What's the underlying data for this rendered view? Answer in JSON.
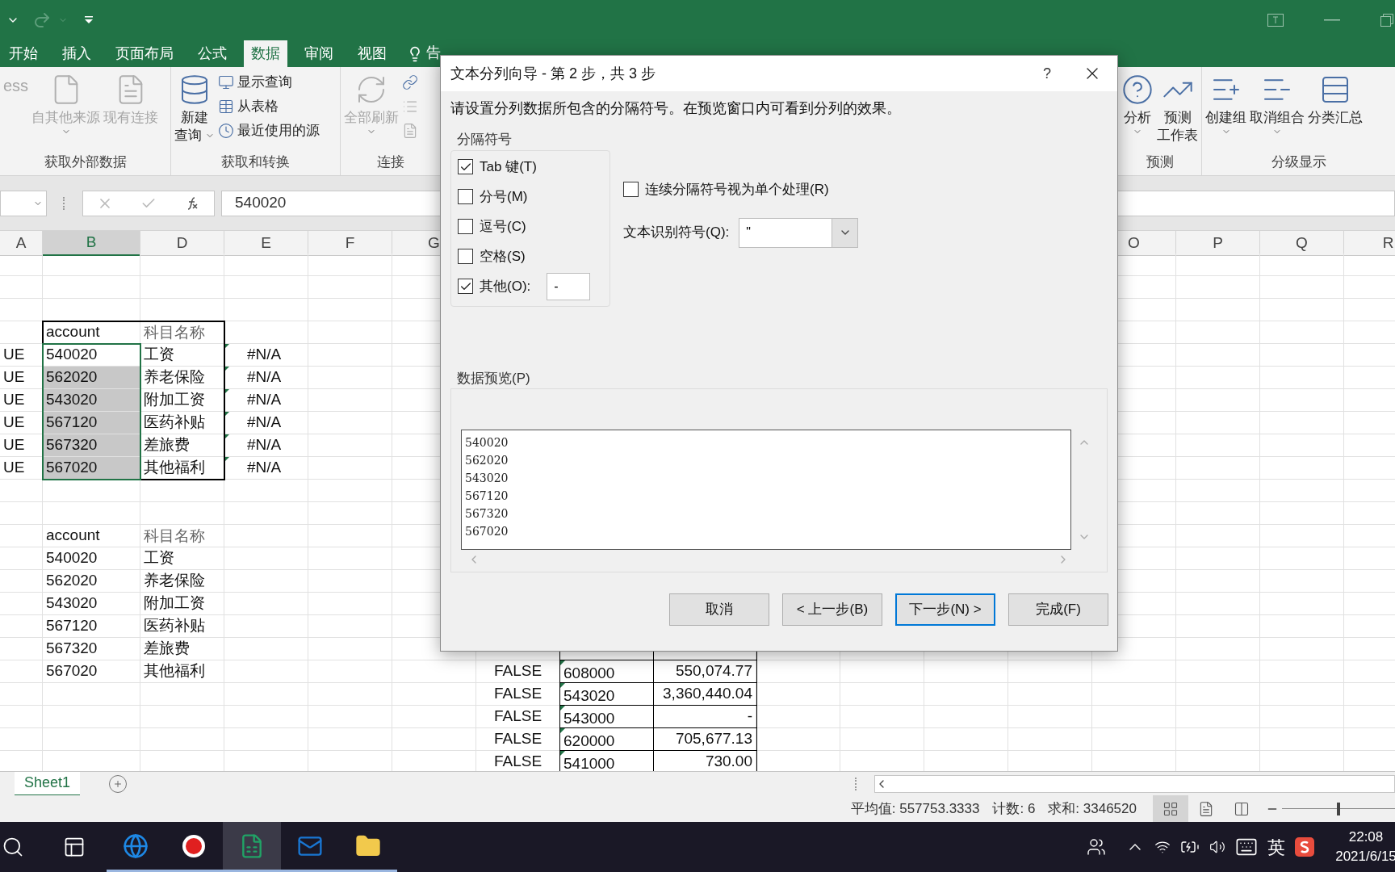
{
  "ribbon_tabs": [
    {
      "label": "开始",
      "selected": false
    },
    {
      "label": "插入",
      "selected": false
    },
    {
      "label": "页面布局",
      "selected": false
    },
    {
      "label": "公式",
      "selected": false
    },
    {
      "label": "数据",
      "selected": true
    },
    {
      "label": "审阅",
      "selected": false
    },
    {
      "label": "视图",
      "selected": false
    }
  ],
  "tell_me": "告",
  "ribbon_left": [
    {
      "label": "获取外部数据",
      "items": [
        {
          "kind": "text",
          "label": "ess",
          "disabled": true
        },
        {
          "kind": "large",
          "lines": [
            "自其他来源"
          ],
          "disabled": true,
          "dropdown": true
        },
        {
          "kind": "large",
          "lines": [
            "现有连接"
          ],
          "disabled": true,
          "dropdown": false
        }
      ]
    },
    {
      "label": "获取和转换",
      "items": [
        {
          "kind": "large",
          "lines": [
            "新建",
            "查询"
          ],
          "disabled": false,
          "dropdown": true
        },
        {
          "kind": "small",
          "label": "显示查询",
          "disabled": false
        },
        {
          "kind": "small",
          "label": "从表格",
          "disabled": false
        },
        {
          "kind": "small",
          "label": "最近使用的源",
          "disabled": false
        }
      ]
    },
    {
      "label": "连接",
      "items": [
        {
          "kind": "large",
          "lines": [
            "全部刷新"
          ],
          "disabled": true,
          "dropdown": true
        },
        {
          "kind": "small",
          "disabled": false
        },
        {
          "kind": "small",
          "disabled": true
        },
        {
          "kind": "small",
          "disabled": true
        }
      ]
    }
  ],
  "ribbon_right": [
    {
      "label": "预测",
      "items": [
        {
          "kind": "large",
          "lines": [
            "分析"
          ],
          "disabled": false,
          "dropdown": true
        },
        {
          "kind": "large",
          "lines": [
            "预测",
            "工作表"
          ],
          "disabled": false,
          "dropdown": false
        }
      ]
    },
    {
      "label": "分级显示",
      "items": [
        {
          "kind": "large",
          "lines": [
            "创建组"
          ],
          "disabled": false,
          "dropdown": true
        },
        {
          "kind": "large",
          "lines": [
            "取消组合"
          ],
          "disabled": false,
          "dropdown": true
        },
        {
          "kind": "large",
          "lines": [
            "分类汇总"
          ],
          "disabled": false,
          "dropdown": false
        }
      ]
    }
  ],
  "formula_bar": {
    "value": "540020"
  },
  "sheet": {
    "columns": [
      {
        "label": "A",
        "selected": false
      },
      {
        "label": "B",
        "selected": true
      },
      {
        "label": "D",
        "selected": false
      },
      {
        "label": "E",
        "selected": false
      },
      {
        "label": "F",
        "selected": false
      },
      {
        "label": "G",
        "selected": false
      },
      {
        "label": "O",
        "selected": false
      },
      {
        "label": "P",
        "selected": false
      },
      {
        "label": "Q",
        "selected": false
      },
      {
        "label": "R",
        "selected": false
      }
    ],
    "table1": {
      "header": {
        "account": "account",
        "name": "科目名称"
      },
      "rows": [
        {
          "col_a": "UE",
          "account": "540020",
          "name": "工资",
          "lookup": "#N/A",
          "selected": true,
          "active": true,
          "error_flag": true
        },
        {
          "col_a": "UE",
          "account": "562020",
          "name": "养老保险",
          "lookup": "#N/A",
          "selected": true,
          "active": false,
          "error_flag": true
        },
        {
          "col_a": "UE",
          "account": "543020",
          "name": "附加工资",
          "lookup": "#N/A",
          "selected": true,
          "active": false,
          "error_flag": true
        },
        {
          "col_a": "UE",
          "account": "567120",
          "name": "医药补贴",
          "lookup": "#N/A",
          "selected": true,
          "active": false,
          "error_flag": true
        },
        {
          "col_a": "UE",
          "account": "567320",
          "name": "差旅费",
          "lookup": "#N/A",
          "selected": true,
          "active": false,
          "error_flag": true
        },
        {
          "col_a": "UE",
          "account": "567020",
          "name": "其他福利",
          "lookup": "#N/A",
          "selected": true,
          "active": false,
          "error_flag": true
        }
      ]
    },
    "table2": {
      "header": {
        "account": "account",
        "name": "科目名称"
      },
      "rows": [
        {
          "account": "540020",
          "name": "工资"
        },
        {
          "account": "562020",
          "name": "养老保险"
        },
        {
          "account": "543020",
          "name": "附加工资"
        },
        {
          "account": "567120",
          "name": "医药补贴"
        },
        {
          "account": "567320",
          "name": "差旅费"
        },
        {
          "account": "567020",
          "name": "其他福利"
        }
      ]
    },
    "table3": {
      "rows": [
        {
          "flag": "FALSE",
          "code": "608000",
          "amount": "550,074.77",
          "error_flag": true
        },
        {
          "flag": "FALSE",
          "code": "543020",
          "amount": "3,360,440.04",
          "error_flag": true
        },
        {
          "flag": "FALSE",
          "code": "543000",
          "amount": "-",
          "error_flag": true
        },
        {
          "flag": "FALSE",
          "code": "620000",
          "amount": "705,677.13",
          "error_flag": true
        },
        {
          "flag": "FALSE",
          "code": "541000",
          "amount": "730.00",
          "error_flag": true
        }
      ]
    }
  },
  "dialog": {
    "title": "文本分列向导 - 第 2 步，共 3 步",
    "help": "?",
    "instruction": "请设置分列数据所包含的分隔符号。在预览窗口内可看到分列的效果。",
    "delimiters": {
      "legend": "分隔符号",
      "options": [
        {
          "label": "Tab 键(T)",
          "checked": true
        },
        {
          "label": "分号(M)",
          "checked": false
        },
        {
          "label": "逗号(C)",
          "checked": false
        },
        {
          "label": "空格(S)",
          "checked": false
        },
        {
          "label": "其他(O):",
          "checked": true,
          "value": "-"
        }
      ]
    },
    "consecutive": {
      "label": "连续分隔符号视为单个处理(R)",
      "checked": false
    },
    "qualifier": {
      "label": "文本识别符号(Q):",
      "value": "\""
    },
    "preview": {
      "label": "数据预览(P)",
      "lines": [
        "540020",
        "562020",
        "543020",
        "567120",
        "567320",
        "567020"
      ]
    },
    "buttons": [
      {
        "label": "取消",
        "focused": false
      },
      {
        "label": "< 上一步(B)",
        "focused": false
      },
      {
        "label": "下一步(N) >",
        "focused": true
      },
      {
        "label": "完成(F)",
        "focused": false
      }
    ]
  },
  "sheet_tabs": [
    {
      "label": "Sheet1",
      "selected": true
    }
  ],
  "status_bar": {
    "average": "平均值: 557753.3333",
    "count": "计数: 6",
    "sum": "求和: 3346520",
    "views": [
      {
        "selected": true
      },
      {
        "selected": false
      },
      {
        "selected": false
      }
    ],
    "zoom": {
      "level": 0.5
    }
  },
  "taskbar": {
    "apps": [
      {
        "running": true,
        "selected": false
      },
      {
        "running": true,
        "selected": false
      },
      {
        "running": true,
        "selected": true
      },
      {
        "running": true,
        "selected": false
      },
      {
        "running": true,
        "selected": false
      }
    ],
    "ime": "英",
    "time": "22:08",
    "date": "2021/6/15"
  }
}
